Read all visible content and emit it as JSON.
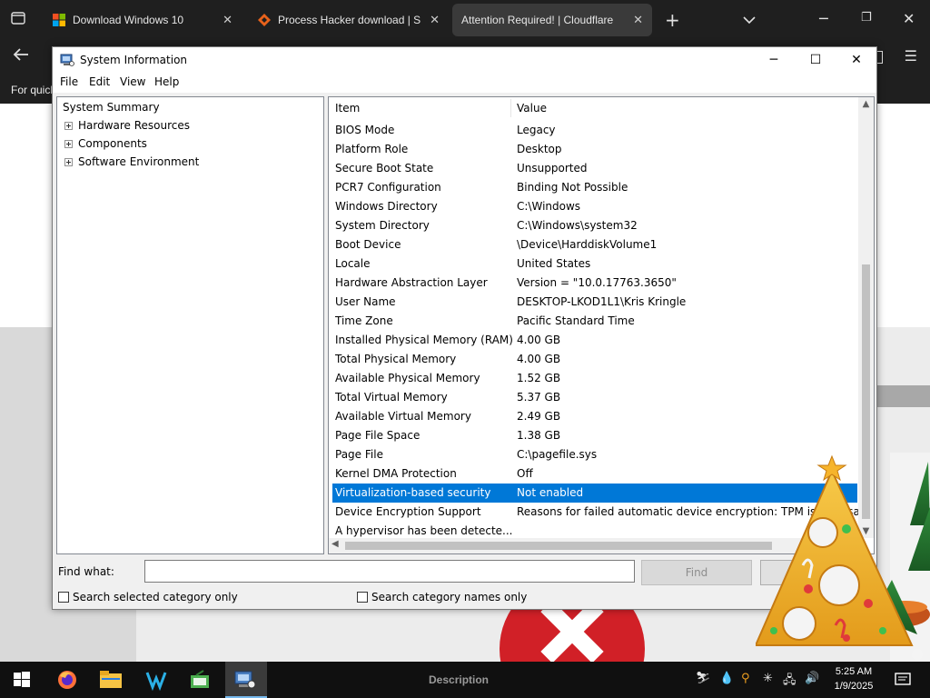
{
  "browser": {
    "tabs": [
      {
        "title": "Download Windows 10"
      },
      {
        "title": "Process Hacker download | Sou"
      },
      {
        "title": "Attention Required! | Cloudflare"
      }
    ],
    "nav_hint": "For quicl"
  },
  "window": {
    "title": "System Information",
    "menu": [
      "File",
      "Edit",
      "View",
      "Help"
    ]
  },
  "tree": {
    "root": "System Summary",
    "children": [
      "Hardware Resources",
      "Components",
      "Software Environment"
    ]
  },
  "list": {
    "headers": {
      "item": "Item",
      "value": "Value"
    },
    "rows": [
      {
        "item": "BIOS Mode",
        "value": "Legacy"
      },
      {
        "item": "Platform Role",
        "value": "Desktop"
      },
      {
        "item": "Secure Boot State",
        "value": "Unsupported"
      },
      {
        "item": "PCR7 Configuration",
        "value": "Binding Not Possible"
      },
      {
        "item": "Windows Directory",
        "value": "C:\\Windows"
      },
      {
        "item": "System Directory",
        "value": "C:\\Windows\\system32"
      },
      {
        "item": "Boot Device",
        "value": "\\Device\\HarddiskVolume1"
      },
      {
        "item": "Locale",
        "value": "United States"
      },
      {
        "item": "Hardware Abstraction Layer",
        "value": "Version = \"10.0.17763.3650\""
      },
      {
        "item": "User Name",
        "value": "DESKTOP-LKOD1L1\\Kris Kringle"
      },
      {
        "item": "Time Zone",
        "value": "Pacific Standard Time"
      },
      {
        "item": "Installed Physical Memory (RAM)",
        "value": "4.00 GB"
      },
      {
        "item": "Total Physical Memory",
        "value": "4.00 GB"
      },
      {
        "item": "Available Physical Memory",
        "value": "1.52 GB"
      },
      {
        "item": "Total Virtual Memory",
        "value": "5.37 GB"
      },
      {
        "item": "Available Virtual Memory",
        "value": "2.49 GB"
      },
      {
        "item": "Page File Space",
        "value": "1.38 GB"
      },
      {
        "item": "Page File",
        "value": "C:\\pagefile.sys"
      },
      {
        "item": "Kernel DMA Protection",
        "value": "Off"
      },
      {
        "item": "Virtualization-based security",
        "value": "Not enabled",
        "selected": true
      },
      {
        "item": "Device Encryption Support",
        "value": "Reasons for failed automatic device encryption: TPM is not usabl"
      },
      {
        "item": "A hypervisor has been detecte...",
        "value": ""
      }
    ]
  },
  "find": {
    "label": "Find what:",
    "value": "",
    "find_button": "Find",
    "find_next_button": "Find",
    "search_selected": "Search selected category only",
    "search_names": "Search category names only"
  },
  "taskbar": {
    "description_label": "Description",
    "time": "5:25 AM",
    "date": "1/9/2025"
  },
  "colors": {
    "selection": "#0078d7",
    "browser_chrome": "#1f1f1f",
    "taskbar": "#101010",
    "error_red": "#d12027"
  },
  "icons": [
    "tab-actions-icon",
    "windows-logo-icon",
    "process-hacker-icon",
    "cloudflare-icon",
    "new-tab-icon",
    "tab-list-chevron-icon",
    "back-icon",
    "hamburger-menu-icon",
    "sysinfo-app-icon",
    "start-icon",
    "firefox-icon",
    "file-explorer-icon",
    "vs-icon",
    "green-app-icon",
    "sysinfo-taskbar-icon",
    "notification-icon"
  ]
}
